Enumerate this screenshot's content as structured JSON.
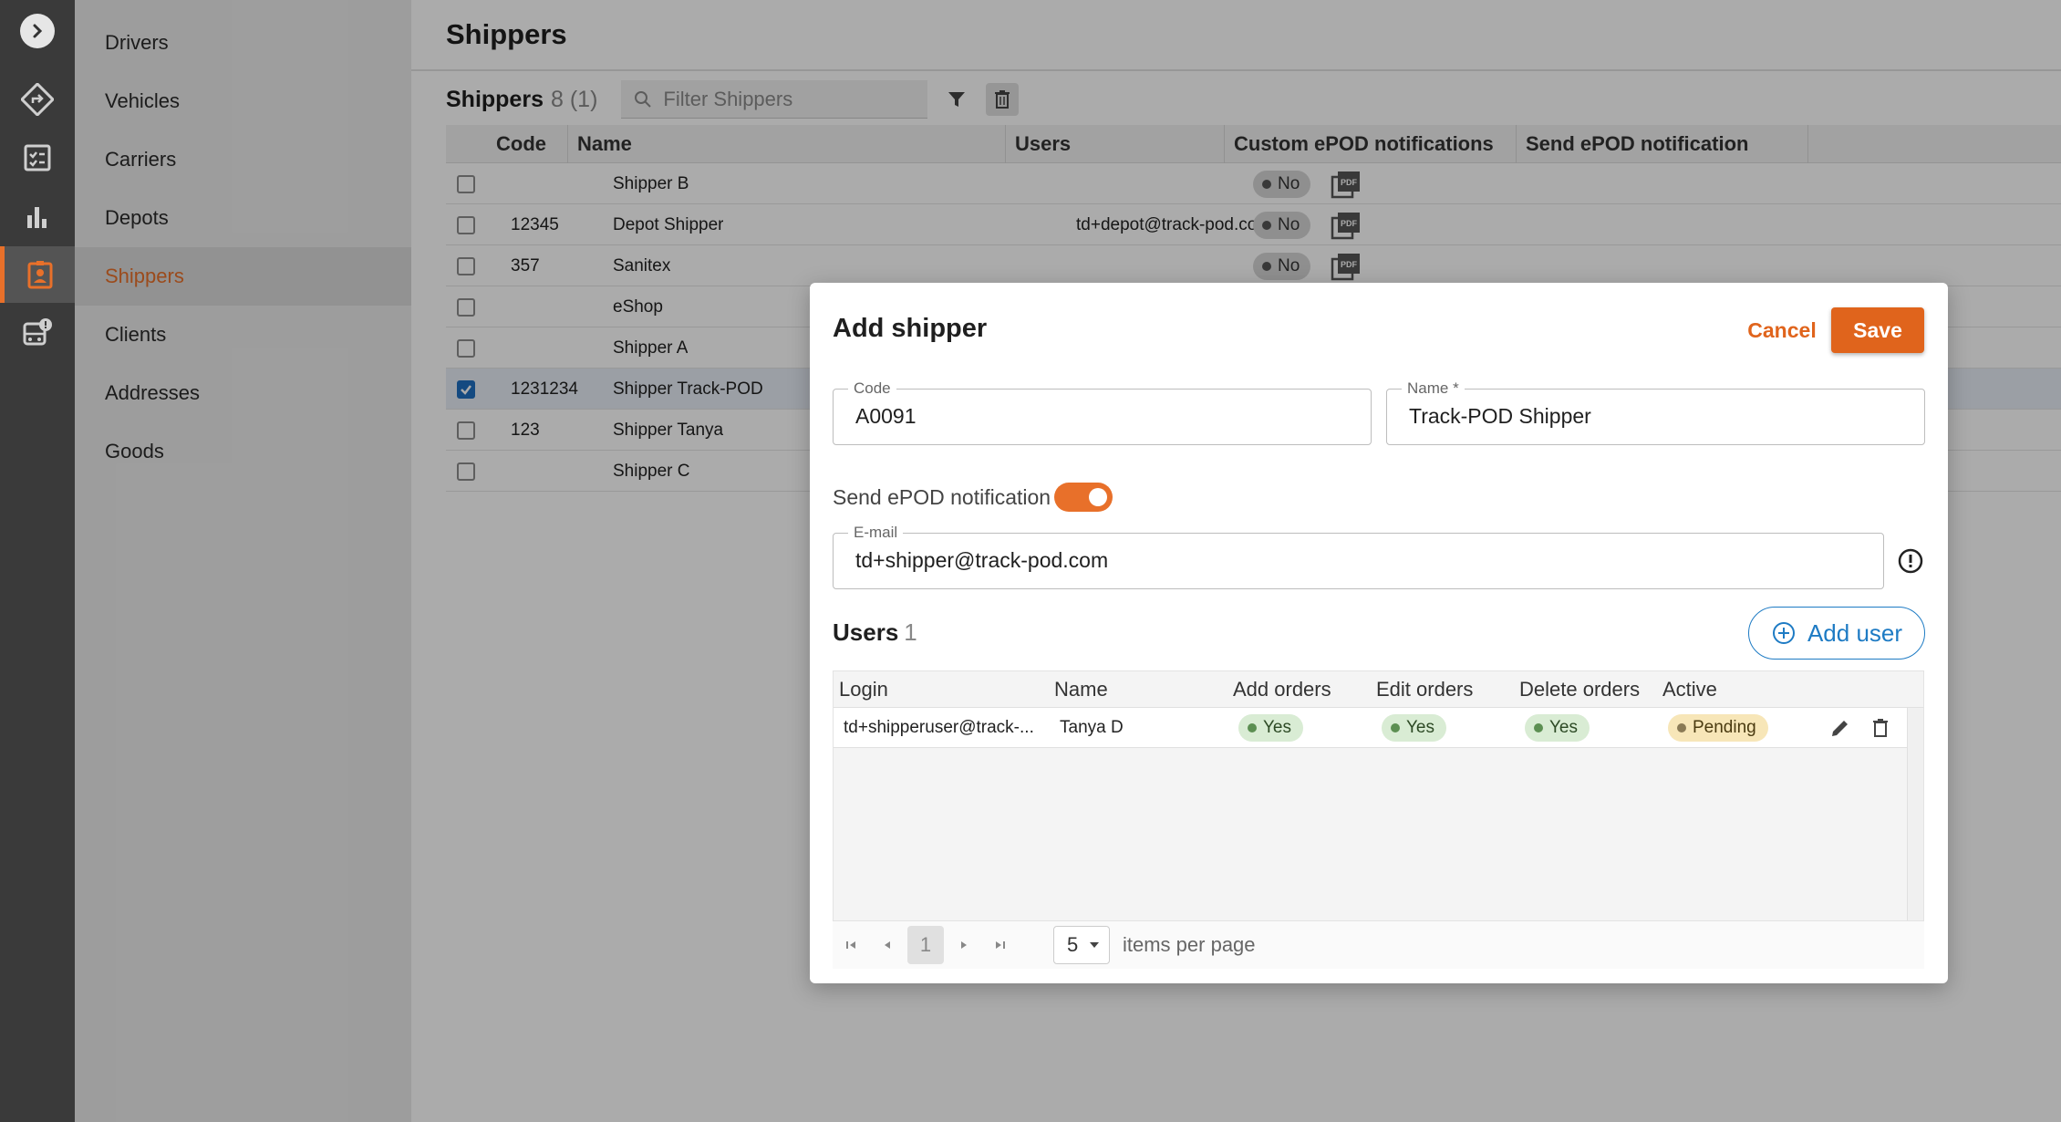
{
  "colors": {
    "accent": "#e0641c",
    "link_blue": "#1e7bc4",
    "rail_bg": "#3a3a3a",
    "nav_bg": "#ebebeb"
  },
  "rail": {
    "icons": [
      "expand-arrow-icon",
      "routes-icon",
      "checklist-icon",
      "bar-chart-icon",
      "shippers-badge-icon",
      "bus-alert-icon"
    ]
  },
  "sidebar": {
    "items": [
      {
        "label": "Drivers"
      },
      {
        "label": "Vehicles"
      },
      {
        "label": "Carriers"
      },
      {
        "label": "Depots"
      },
      {
        "label": "Shippers",
        "active": true
      },
      {
        "label": "Clients"
      },
      {
        "label": "Addresses"
      },
      {
        "label": "Goods"
      }
    ]
  },
  "page": {
    "title": "Shippers",
    "toolbar": {
      "label": "Shippers",
      "count": "8 (1)",
      "filter_placeholder": "Filter Shippers"
    }
  },
  "grid": {
    "columns": [
      "Code",
      "Name",
      "Users",
      "Custom ePOD notifications",
      "Send ePOD notification"
    ],
    "rows": [
      {
        "code": "",
        "name": "Shipper B",
        "users": "",
        "custom": "No",
        "checked": false
      },
      {
        "code": "12345",
        "name": "Depot Shipper",
        "users": "td+depot@track-pod.co...",
        "custom": "No",
        "checked": false
      },
      {
        "code": "357",
        "name": "Sanitex",
        "users": "",
        "custom": "No",
        "checked": false
      },
      {
        "code": "",
        "name": "eShop",
        "users": "",
        "custom": "",
        "checked": false
      },
      {
        "code": "",
        "name": "Shipper A",
        "users": "",
        "custom": "",
        "checked": false
      },
      {
        "code": "1231234",
        "name": "Shipper Track-POD",
        "users": "",
        "custom": "",
        "checked": true
      },
      {
        "code": "123",
        "name": "Shipper Tanya",
        "users": "",
        "custom": "",
        "checked": false
      },
      {
        "code": "",
        "name": "Shipper C",
        "users": "",
        "custom": "",
        "checked": false
      }
    ]
  },
  "dialog": {
    "title": "Add shipper",
    "cancel_label": "Cancel",
    "save_label": "Save",
    "code_label": "Code",
    "code_value": "A0091",
    "name_label": "Name *",
    "name_value": "Track-POD Shipper",
    "toggle_label": "Send ePOD notification",
    "toggle_on": true,
    "email_label": "E-mail",
    "email_value": "td+shipper@track-pod.com",
    "users_label": "Users",
    "users_count": "1",
    "add_user_label": "Add user",
    "users_columns": [
      "Login",
      "Name",
      "Add orders",
      "Edit orders",
      "Delete orders",
      "Active"
    ],
    "users_rows": [
      {
        "login": "td+shipperuser@track-...",
        "name": "Tanya D",
        "add": "Yes",
        "edit": "Yes",
        "delete": "Yes",
        "active": "Pending"
      }
    ],
    "pager": {
      "page": "1",
      "page_size": "5",
      "items_per_page_label": "items per page"
    }
  }
}
